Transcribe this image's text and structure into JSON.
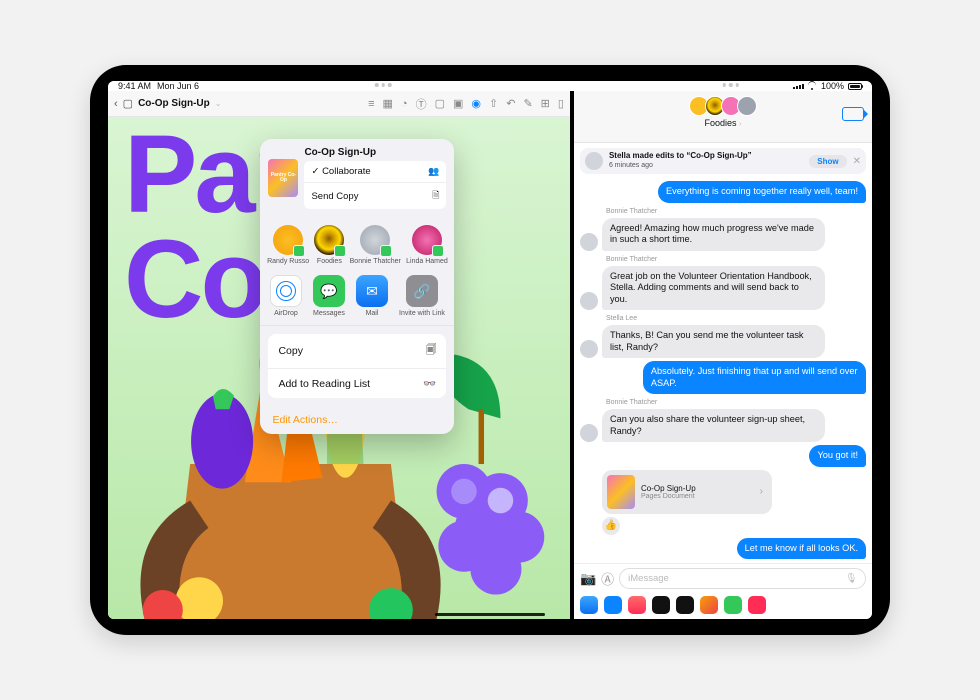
{
  "status_bar": {
    "time": "9:41 AM",
    "date": "Mon Jun 6",
    "battery_pct": "100%"
  },
  "pages": {
    "doc_title": "Co-Op Sign-Up",
    "hero_line1": "Pant",
    "hero_line2": "Co-O"
  },
  "share_sheet": {
    "thumb_label": "Pantry\nCo-Op",
    "doc_title": "Co-Op Sign-Up",
    "mode_collaborate": "Collaborate",
    "mode_send_copy": "Send Copy",
    "contacts": [
      {
        "name": "Randy Russo"
      },
      {
        "name": "Foodies"
      },
      {
        "name": "Bonnie Thatcher"
      },
      {
        "name": "Linda Hamed"
      }
    ],
    "apps": [
      {
        "name": "AirDrop"
      },
      {
        "name": "Messages"
      },
      {
        "name": "Mail"
      },
      {
        "name": "Invite with Link"
      }
    ],
    "actions": {
      "copy": "Copy",
      "reading_list": "Add to Reading List",
      "edit": "Edit Actions…"
    }
  },
  "messages": {
    "group_name": "Foodies",
    "activity": {
      "sender": "Stella",
      "text_prefix": "Stella made edits to",
      "doc": "“Co-Op Sign-Up”",
      "timestamp": "6 minutes ago",
      "show_label": "Show"
    },
    "placeholder": "iMessage",
    "attach": {
      "title": "Co-Op Sign-Up",
      "subtitle": "Pages Document"
    },
    "thread": {
      "m0": "Everything is coming together really well, team!",
      "s1": "Bonnie Thatcher",
      "m1": "Agreed! Amazing how much progress we've made in such a short time.",
      "s2": "Bonnie Thatcher",
      "m2": "Great job on the Volunteer Orientation Handbook, Stella. Adding comments and will send back to you.",
      "s3": "Stella Lee",
      "m3": "Thanks, B! Can you send me the volunteer task list, Randy?",
      "m4": "Absolutely. Just finishing that up and will send over ASAP.",
      "s5": "Bonnie Thatcher",
      "m5": "Can you also share the volunteer sign-up sheet, Randy?",
      "m6": "You got it!",
      "m7": "Let me know if all looks OK."
    }
  }
}
